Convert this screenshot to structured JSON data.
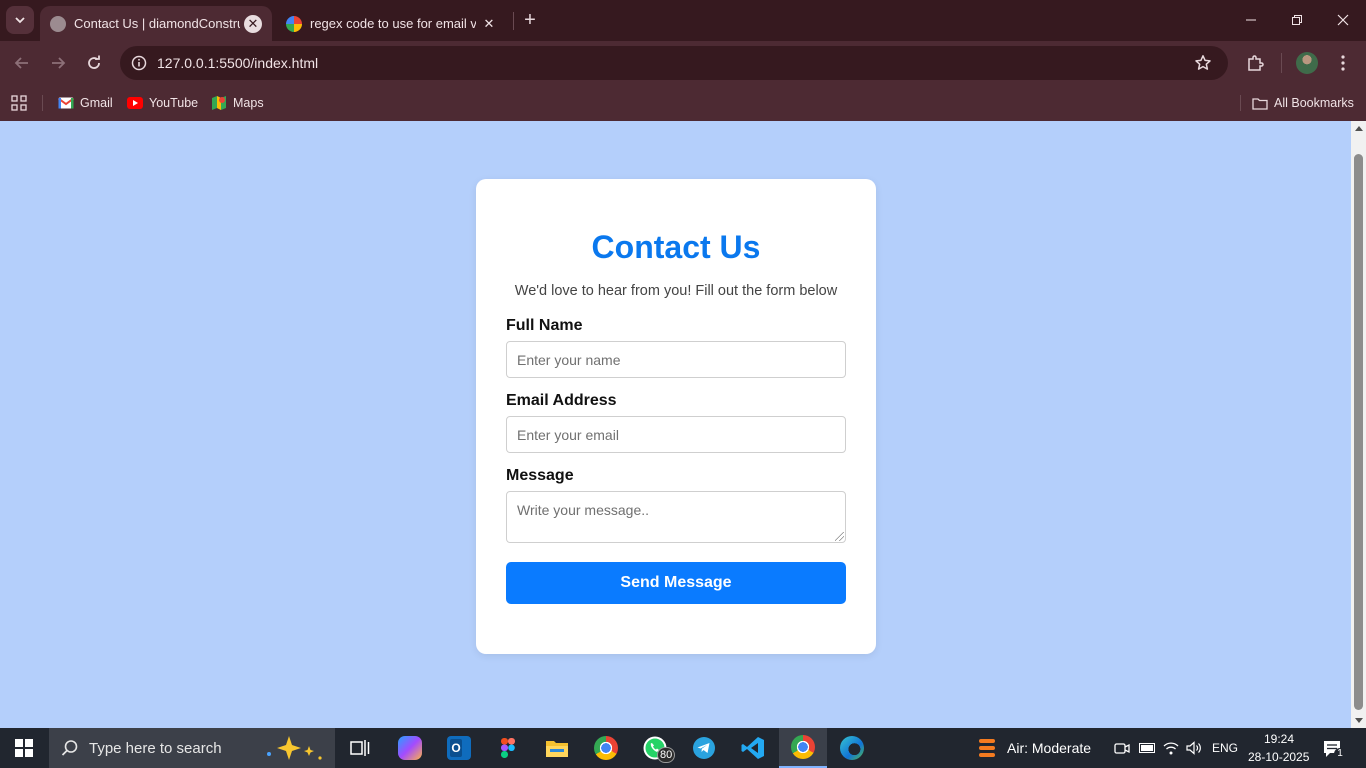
{
  "browser": {
    "tabs": [
      {
        "title": "Contact Us | diamondConstruct",
        "active": true
      },
      {
        "title": "regex code to use for email vali",
        "active": false
      }
    ],
    "url": "127.0.0.1:5500/index.html",
    "bookmarks": [
      {
        "label": "Gmail",
        "icon": "gmail-icon"
      },
      {
        "label": "YouTube",
        "icon": "youtube-icon"
      },
      {
        "label": "Maps",
        "icon": "maps-icon"
      }
    ],
    "all_bookmarks_label": "All Bookmarks",
    "theme": {
      "frame": "#36191f",
      "toolbar": "#4d2a33"
    }
  },
  "page": {
    "background": "#b4cffb",
    "heading": "Contact Us",
    "subtitle": "We'd love to hear from you! Fill out the form below",
    "fields": {
      "name": {
        "label": "Full Name",
        "placeholder": "Enter your name",
        "value": ""
      },
      "email": {
        "label": "Email Address",
        "placeholder": "Enter your email",
        "value": ""
      },
      "message": {
        "label": "Message",
        "placeholder": "Write your message..",
        "value": ""
      }
    },
    "submit_label": "Send Message",
    "accent": "#0a7bff"
  },
  "taskbar": {
    "search_placeholder": "Type here to search",
    "whatsapp_badge": "80",
    "air_quality": "Air: Moderate",
    "language": "ENG",
    "time": "19:24",
    "date": "28-10-2025",
    "notification_count": "1"
  }
}
